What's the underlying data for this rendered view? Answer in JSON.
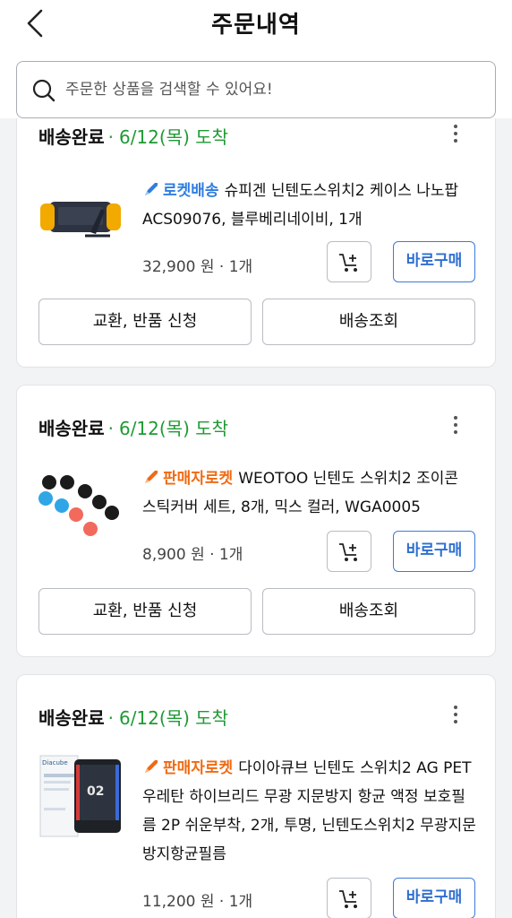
{
  "header": {
    "title": "주문내역"
  },
  "search": {
    "placeholder": "주문한 상품을 검색할 수 있어요!"
  },
  "colors": {
    "rocket": "#2f7de0",
    "seller_rocket": "#f06a12",
    "arrival": "#1f9a34",
    "buy_button": "#2f6fd0"
  },
  "orders": [
    {
      "status": "배송완료",
      "separator": "·",
      "arrival": "6/12(목) 도착",
      "badge": "로켓배송",
      "badge_icon": "rocket-icon",
      "product": "슈피겐 닌텐도스위치2 케이스 나노팝 ACS09076, 블루베리네이비, 1개",
      "price": "32,900 원 · 1개",
      "buy_label": "바로구매",
      "exchange_label": "교환, 반품 신청",
      "tracking_label": "배송조회"
    },
    {
      "status": "배송완료",
      "separator": "·",
      "arrival": "6/12(목) 도착",
      "badge": "판매자로켓",
      "badge_icon": "rocket-icon",
      "product": "WEOTOO 닌텐도 스위치2 조이콘 스틱커버 세트, 8개, 믹스 컬러, WGA0005",
      "price": "8,900 원 · 1개",
      "buy_label": "바로구매",
      "exchange_label": "교환, 반품 신청",
      "tracking_label": "배송조회"
    },
    {
      "status": "배송완료",
      "separator": "·",
      "arrival": "6/12(목) 도착",
      "badge": "판매자로켓",
      "badge_icon": "rocket-icon",
      "product": "다이아큐브 닌텐도 스위치2 AG PET 우레탄 하이브리드 무광 지문방지 항균 액정 보호필름 2P 쉬운부착, 2개, 투명, 닌텐도스위치2 무광지문방지항균필름",
      "price": "11,200 원 · 1개",
      "buy_label": "바로구매",
      "thumb_brand": "Diacube",
      "thumb_screen_text": "02"
    }
  ]
}
